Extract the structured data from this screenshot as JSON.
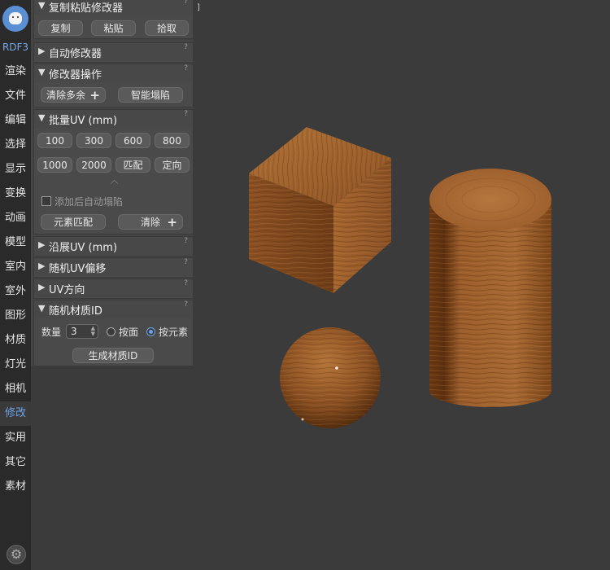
{
  "sidebar": {
    "logo": "bear-logo-icon",
    "brand": "RDF3",
    "items": [
      "渲染",
      "文件",
      "编辑",
      "选择",
      "显示",
      "变换",
      "动画",
      "模型",
      "室内",
      "室外",
      "图形",
      "材质",
      "灯光",
      "相机",
      "修改",
      "实用",
      "其它",
      "素材"
    ],
    "active": "修改",
    "settings_icon": "gear-icon"
  },
  "panel": {
    "copy_paste": {
      "title": "复制粘贴修改器",
      "help": "?",
      "buttons": [
        "复制",
        "粘贴",
        "拾取"
      ]
    },
    "auto_modifier": {
      "title": "自动修改器",
      "help": "?"
    },
    "modifier_ops": {
      "title": "修改器操作",
      "help": "?",
      "clear_label": "清除多余",
      "collapse_label": "智能塌陷"
    },
    "batch_uv": {
      "title": "批量UV (mm)",
      "help": "?",
      "row1": [
        "100",
        "300",
        "600",
        "800"
      ],
      "row2": [
        "1000",
        "2000",
        "匹配",
        "定向"
      ],
      "auto_collapse_label": "添加后自动塌陷",
      "auto_collapse_checked": false,
      "element_match_label": "元素匹配",
      "clear_label": "清除"
    },
    "extend_uv": {
      "title": "沿展UV (mm)",
      "help": "?"
    },
    "random_uv": {
      "title": "随机UV偏移",
      "help": "?"
    },
    "uv_direction": {
      "title": "UV方向",
      "help": "?"
    },
    "random_mat": {
      "title": "随机材质ID",
      "help": "?",
      "count_label": "数量",
      "count_value": "3",
      "by_face": "按面",
      "by_element": "按元素",
      "selected": "按元素",
      "generate_label": "生成材质ID"
    }
  },
  "viewport": {
    "label": "]",
    "objects": [
      "wood-cube",
      "wood-cylinder",
      "wood-sphere"
    ]
  },
  "colors": {
    "accent": "#6ea2e8",
    "wood_light": "#a86a32",
    "wood_dark": "#6e3d16"
  }
}
